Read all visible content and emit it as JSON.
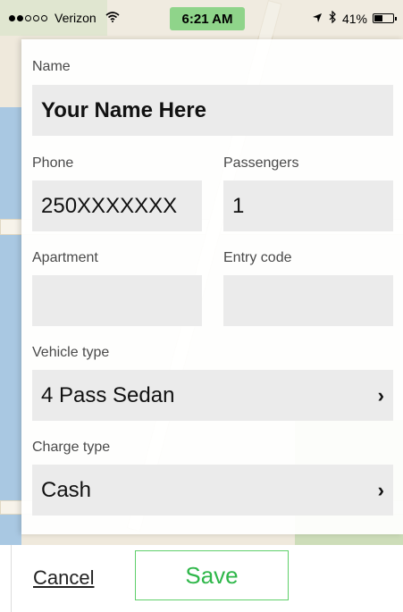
{
  "status_bar": {
    "carrier": "Verizon",
    "time": "6:21 AM",
    "battery_percent": "41%",
    "battery_level": 0.41,
    "signal_bars_filled": 2,
    "signal_bars_total": 5,
    "icons": [
      "wifi-icon",
      "location-arrow-icon",
      "bluetooth-icon",
      "battery-icon"
    ]
  },
  "form": {
    "name": {
      "label": "Name",
      "value": "Your Name Here"
    },
    "phone": {
      "label": "Phone",
      "value_prefix": "250",
      "value_masked": "XXXXXXX"
    },
    "passengers": {
      "label": "Passengers",
      "value": "1"
    },
    "apartment": {
      "label": "Apartment",
      "value": ""
    },
    "entry_code": {
      "label": "Entry code",
      "value": ""
    },
    "vehicle_type": {
      "label": "Vehicle type",
      "value": "4 Pass Sedan"
    },
    "charge_type": {
      "label": "Charge type",
      "value": "Cash"
    }
  },
  "actions": {
    "cancel_label": "Cancel",
    "save_label": "Save"
  },
  "colors": {
    "time_pill": "#8fd48a",
    "save_accent": "#2fb74a",
    "field_bg": "#ebebeb"
  }
}
